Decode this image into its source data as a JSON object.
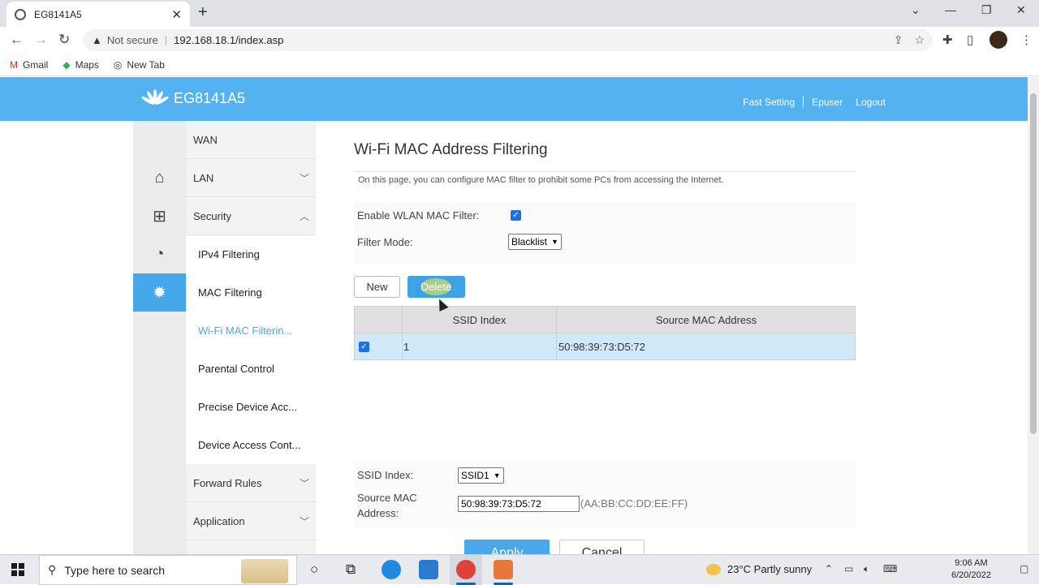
{
  "browser": {
    "tab_title": "EG8141A5",
    "tab_close": "✕",
    "new_tab": "+",
    "not_secure": "Not secure",
    "url": "192.168.18.1/index.asp",
    "bookmarks": [
      {
        "label": "Gmail",
        "icon": "gmail-icon"
      },
      {
        "label": "Maps",
        "icon": "maps-icon"
      },
      {
        "label": "New Tab",
        "icon": "globe-icon"
      }
    ]
  },
  "header": {
    "logo_text": "EG8141A5",
    "links": [
      "Fast Setting",
      "Epuser",
      "Logout"
    ]
  },
  "menu": {
    "items": [
      {
        "label": "WAN"
      },
      {
        "label": "LAN"
      },
      {
        "label": "Security"
      },
      {
        "label": "Forward Rules"
      },
      {
        "label": "Application"
      }
    ],
    "security_sub": [
      {
        "label": "IPv4 Filtering"
      },
      {
        "label": "MAC Filtering"
      },
      {
        "label": "Wi-Fi MAC Filterin..."
      },
      {
        "label": "Parental Control"
      },
      {
        "label": "Precise Device Acc..."
      },
      {
        "label": "Device Access Cont..."
      }
    ]
  },
  "content": {
    "title": "Wi-Fi MAC Address Filtering",
    "description": "On this page, you can configure MAC filter to prohibit some PCs from accessing the Internet.",
    "enable_label": "Enable WLAN MAC Filter:",
    "enable_checked": true,
    "filter_mode_label": "Filter Mode:",
    "filter_mode_value": "Blacklist",
    "new_button": "New",
    "delete_button": "Delete",
    "table": {
      "headers": [
        "SSID Index",
        "Source MAC Address"
      ],
      "rows": [
        {
          "checked": true,
          "ssid_index": "1",
          "mac": "50:98:39:73:D5:72"
        }
      ]
    },
    "ssid_label": "SSID Index:",
    "ssid_value": "SSID1",
    "mac_label": "Source MAC Address:",
    "mac_value": "50:98:39:73:D5:72",
    "mac_hint": "(AA:BB:CC:DD:EE:FF)",
    "apply_button": "Apply",
    "cancel_button": "Cancel"
  },
  "taskbar": {
    "search_placeholder": "Type here to search",
    "weather": "23°C  Partly sunny",
    "time": "9:06 AM",
    "date": "6/20/2022"
  }
}
